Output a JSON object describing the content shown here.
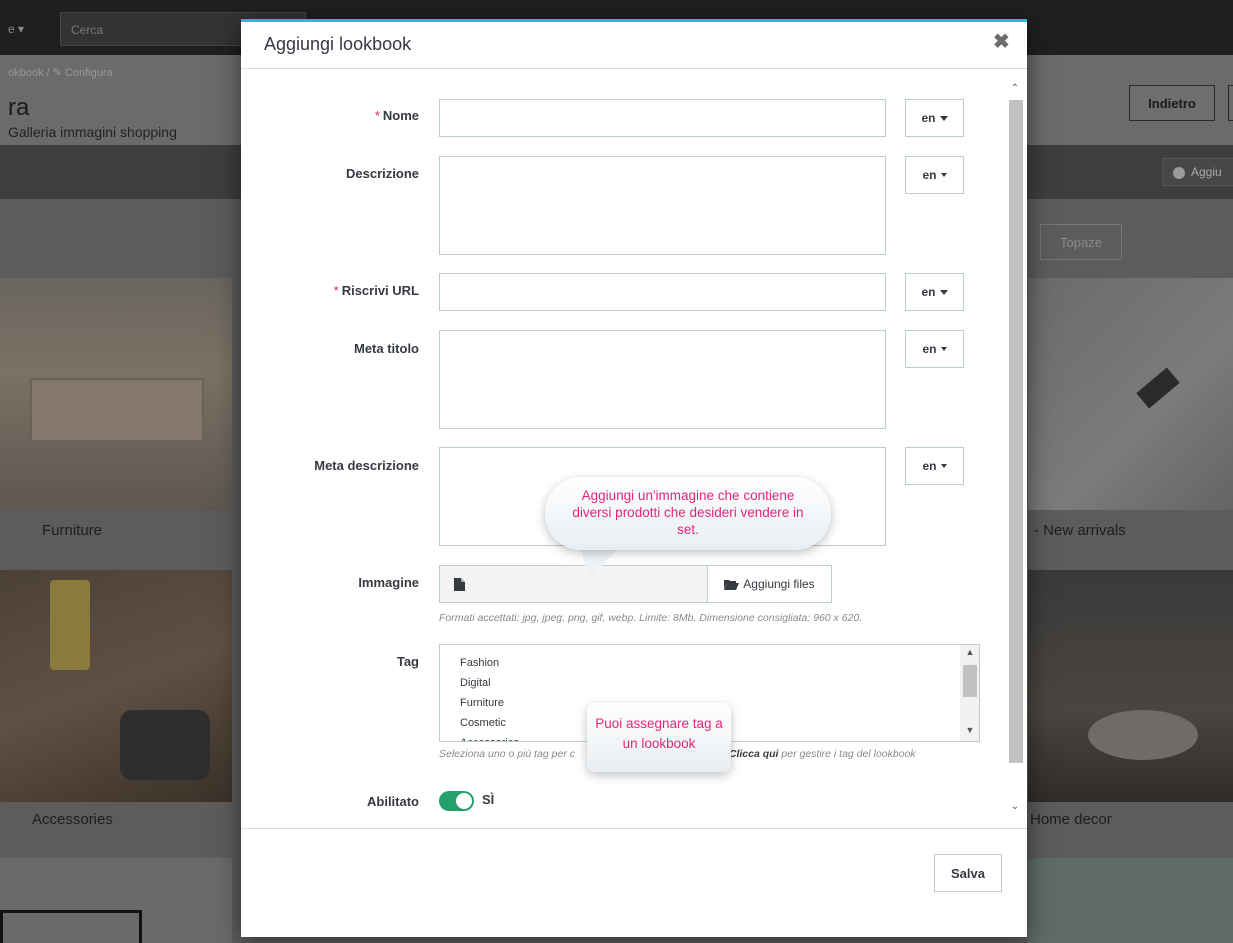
{
  "background": {
    "menu_toggle": "e ▾",
    "search_placeholder": "Cerca",
    "breadcrumb": "okbook  /  ✎ Configura",
    "title": "ra",
    "subtitle": "Galleria immagini shopping",
    "back_button": "Indietro",
    "add_button": "Aggiu",
    "filter_button": "Topaze",
    "tiles": [
      "Furniture",
      "- New arrivals",
      "Accessories",
      "Home decor"
    ]
  },
  "modal": {
    "title": "Aggiungi lookbook",
    "close_icon": "close-icon",
    "required_mark": "*",
    "fields": {
      "name_label": "Nome",
      "description_label": "Descrizione",
      "url_label": "Riscrivi URL",
      "meta_title_label": "Meta titolo",
      "meta_description_label": "Meta descrizione",
      "image_label": "Immagine",
      "tag_label": "Tag",
      "enabled_label": "Abilitato"
    },
    "lang": "en",
    "image": {
      "add_files_button": "Aggiungi files",
      "help": "Formati accettati: jpg, jpeg, png, gif, webp. Limite: 8Mb. Dimensione consigliata: 960 x 620."
    },
    "tags": {
      "options": [
        "Fashion",
        "Digital",
        "Furniture",
        "Cosmetic",
        "Accessories"
      ],
      "help_before": "Seleziona uno o più tag per c",
      "help_link": "Clicca qui",
      "help_after": "per gestire i tag del lookbook",
      "help_mid": "."
    },
    "enabled": {
      "on": true,
      "label": "SÌ",
      "color": "#24a06d"
    },
    "save_button": "Salva"
  },
  "callouts": {
    "image_tip": "Aggiungi un'immagine che contiene diversi prodotti che desideri vendere in set.",
    "tag_tip": "Puoi assegnare tag a un lookbook",
    "color": "#e3267a"
  },
  "colors": {
    "accent": "#25b9d7",
    "required": "#e0245e"
  }
}
